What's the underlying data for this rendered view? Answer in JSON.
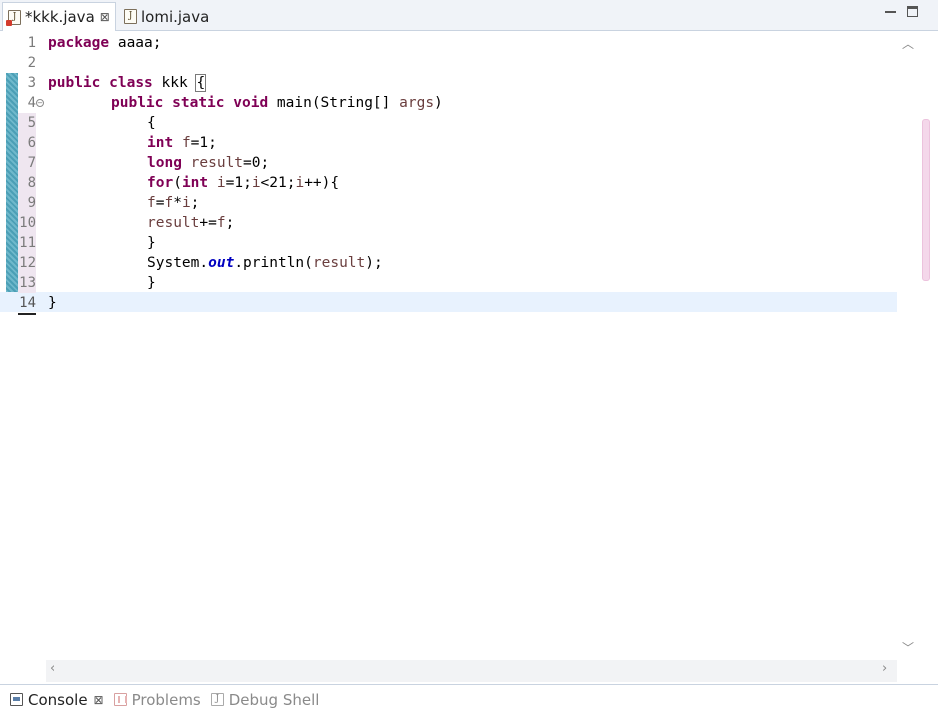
{
  "tabs": [
    {
      "label": "*kkk.java",
      "close": "⊠"
    },
    {
      "label": "lomi.java"
    }
  ],
  "editor": {
    "lines": [
      {
        "n": "1"
      },
      {
        "n": "2"
      },
      {
        "n": "3"
      },
      {
        "n": "4"
      },
      {
        "n": "5"
      },
      {
        "n": "6"
      },
      {
        "n": "7"
      },
      {
        "n": "8"
      },
      {
        "n": "9"
      },
      {
        "n": "10"
      },
      {
        "n": "11"
      },
      {
        "n": "12"
      },
      {
        "n": "13"
      },
      {
        "n": "14"
      }
    ],
    "tokens": {
      "l1_kw": "package",
      "l1_rest": " aaaa;",
      "l3_kw1": "public",
      "l3_kw2": "class",
      "l3_name": " kkk ",
      "l3_brace": "{",
      "l4_kw1": "public",
      "l4_kw2": "static",
      "l4_kw3": "void",
      "l4_rest": " main(String[] ",
      "l4_args": "args",
      "l4_close": ")",
      "l5": "{",
      "l6_kw": "int",
      "l6_var": "f",
      "l6_rest": "=1;",
      "l7_kw": "long",
      "l7_var": "result",
      "l7_rest": "=0;",
      "l8_kw": "for",
      "l8_paren": "(",
      "l8_kw2": "int",
      "l8_var1": "i",
      "l8_mid1": "=1;",
      "l8_var2": "i",
      "l8_mid2": "<21;",
      "l8_var3": "i",
      "l8_end": "++){",
      "l9_var1": "f",
      "l9_eq": "=",
      "l9_var2": "f",
      "l9_op": "*",
      "l9_var3": "i",
      "l9_end": ";",
      "l10_var1": "result",
      "l10_op": "+=",
      "l10_var2": "f",
      "l10_end": ";",
      "l11": "}",
      "l12_pre": "System.",
      "l12_field": "out",
      "l12_mid": ".println(",
      "l12_var": "result",
      "l12_end": ");",
      "l13": "}",
      "l14": "}"
    }
  },
  "views": [
    {
      "label": "Console",
      "close": "⊠"
    },
    {
      "label": "Problems"
    },
    {
      "label": "Debug Shell"
    }
  ],
  "colors": {
    "keyword": "#7f0055",
    "local_variable": "#6a3e3e",
    "static_field": "#0000c0",
    "current_line": "#e8f2fe",
    "change_ruler": "#4b9fb6"
  },
  "icons": {
    "java_file_error": "java-file-error-icon",
    "java_file": "java-file-icon",
    "console": "console-icon",
    "problems": "problems-icon",
    "debug_shell": "debug-shell-icon"
  }
}
